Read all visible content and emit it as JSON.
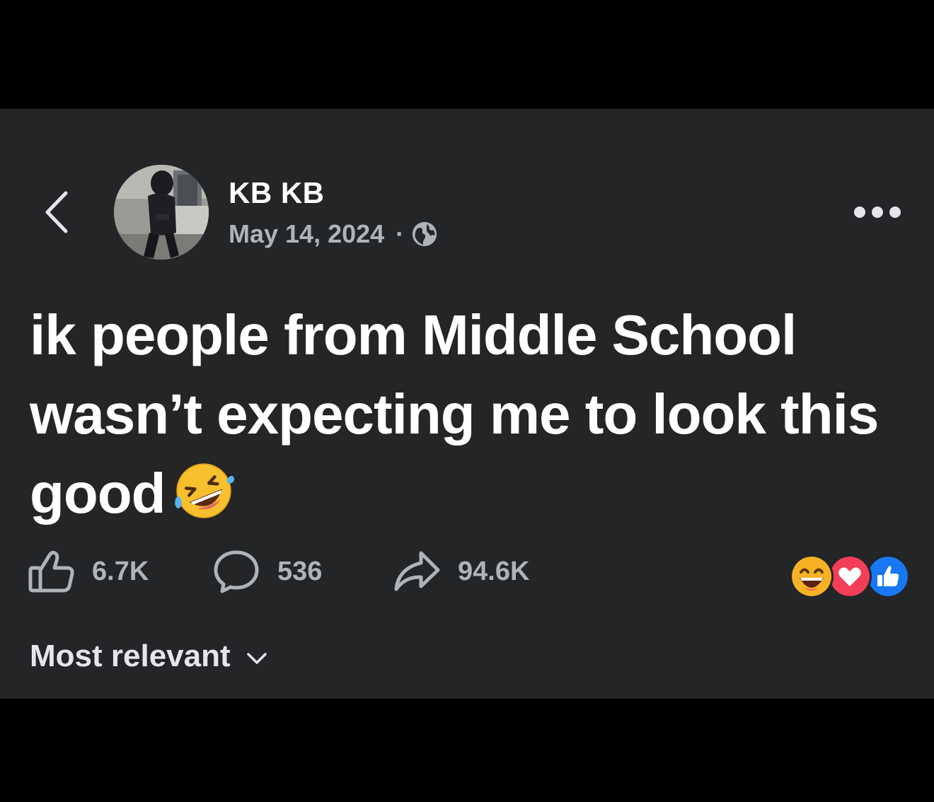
{
  "post": {
    "author_name": "KB KB",
    "date": "May 14, 2024",
    "separator": "·",
    "privacy_icon": "globe-icon",
    "body": "ik people from Middle School wasn’t expecting me to look this good",
    "body_emoji": "rolling-on-the-floor-laughing-emoji"
  },
  "header": {
    "back_icon": "chevron-left-icon",
    "more_icon": "more-horizontal-icon"
  },
  "actions": {
    "like_count": "6.7K",
    "comment_count": "536",
    "share_count": "94.6K"
  },
  "reactions": [
    "haha-reaction",
    "love-reaction",
    "like-reaction"
  ],
  "comments": {
    "sort_label": "Most relevant"
  },
  "colors": {
    "panel_bg": "#232527",
    "text_primary": "#ffffff",
    "text_secondary": "#b0b3b8",
    "like_blue": "#1877f2",
    "love_red": "#f33e58",
    "haha_yellow": "#f7b125"
  }
}
